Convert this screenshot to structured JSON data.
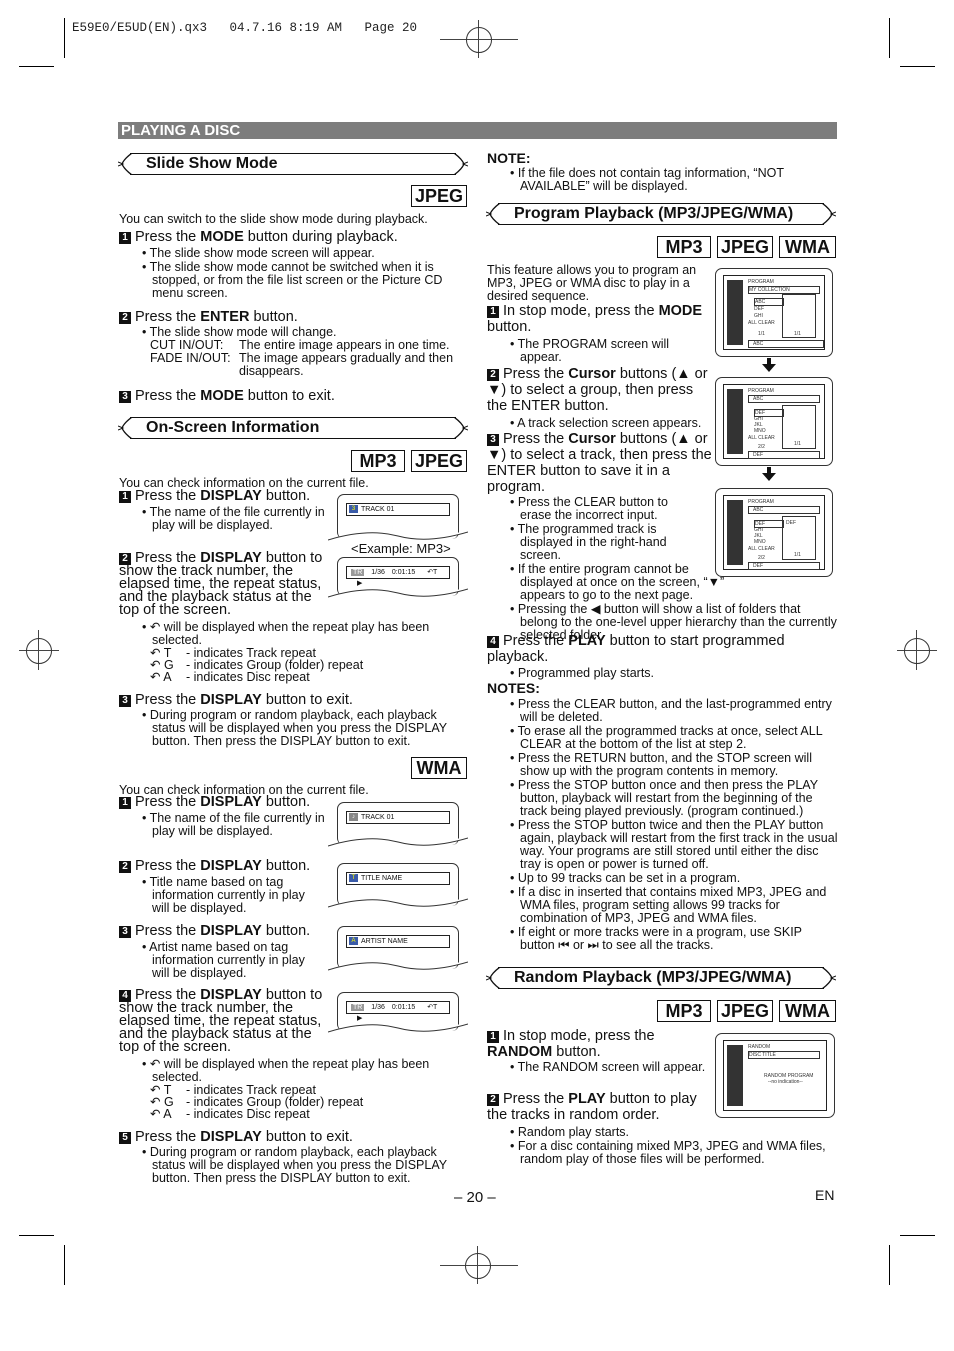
{
  "print_header": "E59E0/E5UD(EN).qx3   04.7.16 8:19 AM   Page 20",
  "section_title": "PLAYING A DISC",
  "slide_show": {
    "title": "Slide Show Mode",
    "tags": [
      "JPEG"
    ],
    "intro": "You can switch to the slide show mode during playback.",
    "step1": {
      "num": "1",
      "pre": "Press the ",
      "bold": "MODE",
      "post": " button during playback."
    },
    "step1_bullets": [
      "The slide show mode screen will appear.",
      "The slide show mode cannot be switched when it is stopped, or from the file list screen or the Picture CD menu screen."
    ],
    "step2": {
      "num": "2",
      "pre": "Press the ",
      "bold": "ENTER",
      "post": " button."
    },
    "step2_bullet": "The slide show mode will change.",
    "cut_label": "CUT IN/OUT:",
    "cut_text": "The entire image appears in one time.",
    "fade_label": "FADE IN/OUT:",
    "fade_text": "The image appears gradually and then disappears.",
    "step3": {
      "num": "3",
      "pre": "Press the ",
      "bold": "MODE",
      "post": " button to exit."
    }
  },
  "onscreen": {
    "title": "On-Screen Information",
    "tags": [
      "MP3",
      "JPEG"
    ],
    "intro": "You can check information on the current file.",
    "step1": {
      "num": "1",
      "pre": "Press the ",
      "bold": "DISPLAY",
      "post": " button."
    },
    "step1_bullet": "The name of the file currently in play will be displayed.",
    "screen1_text": "TRACK 01",
    "example_caption": "<Example: MP3>",
    "step2": {
      "num": "2",
      "pre": "Press the ",
      "bold": "DISPLAY",
      "post": " button to show the track number, the elapsed time, the repeat status, and the playback status at the top of the screen."
    },
    "screen2": {
      "badge": "TR",
      "track": "1/36",
      "time": "0:01:15",
      "repeat": "↶T",
      "play": "▶"
    },
    "repeat_note": "↶ will be displayed when the repeat play has been selected.",
    "repeat_items": [
      {
        "code": "↶ T",
        "desc": "- indicates Track repeat"
      },
      {
        "code": "↶ G",
        "desc": "- indicates Group (folder) repeat"
      },
      {
        "code": "↶ A",
        "desc": "- indicates Disc repeat"
      }
    ],
    "step3": {
      "num": "3",
      "pre": "Press the ",
      "bold": "DISPLAY",
      "post": " button to exit."
    },
    "step3_bullet": "During program or random playback, each playback status will be displayed when you press the DISPLAY button. Then press the DISPLAY button to exit."
  },
  "wma": {
    "tag": "WMA",
    "intro": "You can check information on the current file.",
    "step1": {
      "num": "1",
      "pre": "Press the ",
      "bold": "DISPLAY",
      "post": " button."
    },
    "step1_bullet": "The name of the file currently in play will be displayed.",
    "screen1_text": "TRACK 01",
    "step2": {
      "num": "2",
      "pre": "Press the ",
      "bold": "DISPLAY",
      "post": " button."
    },
    "step2_bullet": "Title name based on tag information currently in play will be displayed.",
    "screen2_text": "TITLE NAME",
    "step3": {
      "num": "3",
      "pre": "Press the ",
      "bold": "DISPLAY",
      "post": " button."
    },
    "step3_bullet": "Artist name based on tag information currently in play will be displayed.",
    "screen3_text": "ARTIST NAME",
    "step4": {
      "num": "4",
      "pre": "Press the ",
      "bold": "DISPLAY",
      "post": " button to show the track number, the elapsed time, the repeat status, and the playback status at the top of the screen."
    },
    "screen4": {
      "badge": "TR",
      "track": "1/36",
      "time": "0:01:15",
      "repeat": "↶T",
      "play": "▶"
    },
    "repeat_note": "↶ will be displayed when the repeat play has been selected.",
    "repeat_items": [
      {
        "code": "↶ T",
        "desc": "- indicates Track repeat"
      },
      {
        "code": "↶ G",
        "desc": "- indicates Group (folder) repeat"
      },
      {
        "code": "↶ A",
        "desc": "- indicates Disc repeat"
      }
    ],
    "step5": {
      "num": "5",
      "pre": "Press the ",
      "bold": "DISPLAY",
      "post": " button to exit."
    },
    "step5_bullet": "During program or random playback, each playback status will be displayed when you press the DISPLAY button. Then press the DISPLAY button to exit."
  },
  "note": {
    "heading": "NOTE:",
    "text": "If the file does not contain tag information, “NOT AVAILABLE” will be displayed."
  },
  "program": {
    "title": "Program Playback (MP3/JPEG/WMA)",
    "tags": [
      "MP3",
      "JPEG",
      "WMA"
    ],
    "intro": "This feature allows you to program an MP3, JPEG or WMA disc to play in a desired sequence.",
    "step1": {
      "num": "1",
      "pre": "In stop mode, press the ",
      "bold": "MODE",
      "post": " button."
    },
    "step1_bullet": "The PROGRAM screen will appear.",
    "step2": {
      "num": "2",
      "pre": "Press the ",
      "bold": "Cursor",
      "post": " buttons (▲ or ▼) to select a group, then press the ENTER button."
    },
    "step2_bullet": "A track selection screen appears.",
    "step3": {
      "num": "3",
      "pre": "Press the ",
      "bold": "Cursor",
      "post": " buttons (▲ or ▼) to select a track, then press the ENTER button to save it in a program."
    },
    "step3_bullets": [
      "Press the CLEAR button to erase the incorrect input.",
      "The programmed track is displayed in the right-hand screen.",
      "If the entire program cannot be displayed at once on the screen, “▼” appears to go to the next page.",
      "Pressing the ◀ button will show a list of folders that belong to the one-level upper hierarchy than the currently selected folder."
    ],
    "step4": {
      "num": "4",
      "pre": "Press the ",
      "bold": "PLAY",
      "post": " button to start programmed playback."
    },
    "step4_bullet": "Programmed play starts.",
    "screens": [
      {
        "title": "PROGRAM",
        "header": "MY COLLECTION",
        "items": [
          "ABC",
          "DEF",
          "GHI"
        ],
        "all_clear": "ALL CLEAR",
        "page": "1/1",
        "right_page": "1/1",
        "right_items": [],
        "footer": "ABC"
      },
      {
        "title": "PROGRAM",
        "header": "ABC",
        "items": [
          "DEF",
          "GHI",
          "JKL",
          "MNO"
        ],
        "all_clear": "ALL CLEAR",
        "page": "2/2",
        "right_page": "1/1",
        "right_items": [],
        "footer": "DEF"
      },
      {
        "title": "PROGRAM",
        "header": "ABC",
        "items": [
          "DEF",
          "GHI",
          "JKL",
          "MNO"
        ],
        "all_clear": "ALL CLEAR",
        "page": "2/2",
        "right_page": "1/1",
        "right_items": [
          "DEF"
        ],
        "footer": "DEF"
      }
    ]
  },
  "notes": {
    "heading": "NOTES:",
    "items": [
      "Press the CLEAR button, and the last-programmed entry will be deleted.",
      "To erase all the programmed tracks at once, select ALL CLEAR at the bottom of the list at step 2.",
      "Press the RETURN button, and the STOP screen will show up with the program contents in memory.",
      "Press the STOP button once and then press the PLAY button, playback will restart from the beginning of the track being played previously. (program continued.)",
      "Press the STOP button twice and then the PLAY button again, playback will restart from the first track in the usual way. Your programs are still stored until either the disc tray is open or power is turned off.",
      "Up to 99 tracks can be set in a program.",
      "If a disc in inserted that contains mixed MP3, JPEG and WMA files, program setting allows 99 tracks for combination of MP3, JPEG and WMA files.",
      "If eight or more tracks were in a program, use SKIP button ⏮ or ⏭ to see all the tracks."
    ]
  },
  "random": {
    "title": "Random Playback (MP3/JPEG/WMA)",
    "tags": [
      "MP3",
      "JPEG",
      "WMA"
    ],
    "step1": {
      "num": "1",
      "pre": "In stop mode, press the ",
      "bold": "RANDOM",
      "post": " button."
    },
    "step1_bullet": "The RANDOM screen will appear.",
    "step2": {
      "num": "2",
      "pre": "Press the ",
      "bold": "PLAY",
      "post": " button to play the tracks in random order."
    },
    "step2_bullets": [
      "Random play starts.",
      "For a disc containing mixed MP3, JPEG and WMA files, random play of those files will be performed."
    ],
    "screen": {
      "title": "RANDOM",
      "header": "DISC TITLE",
      "line1": "RANDOM PROGRAM",
      "line2": "--no indication--"
    }
  },
  "footer": {
    "page": "– 20 –",
    "lang": "EN"
  }
}
